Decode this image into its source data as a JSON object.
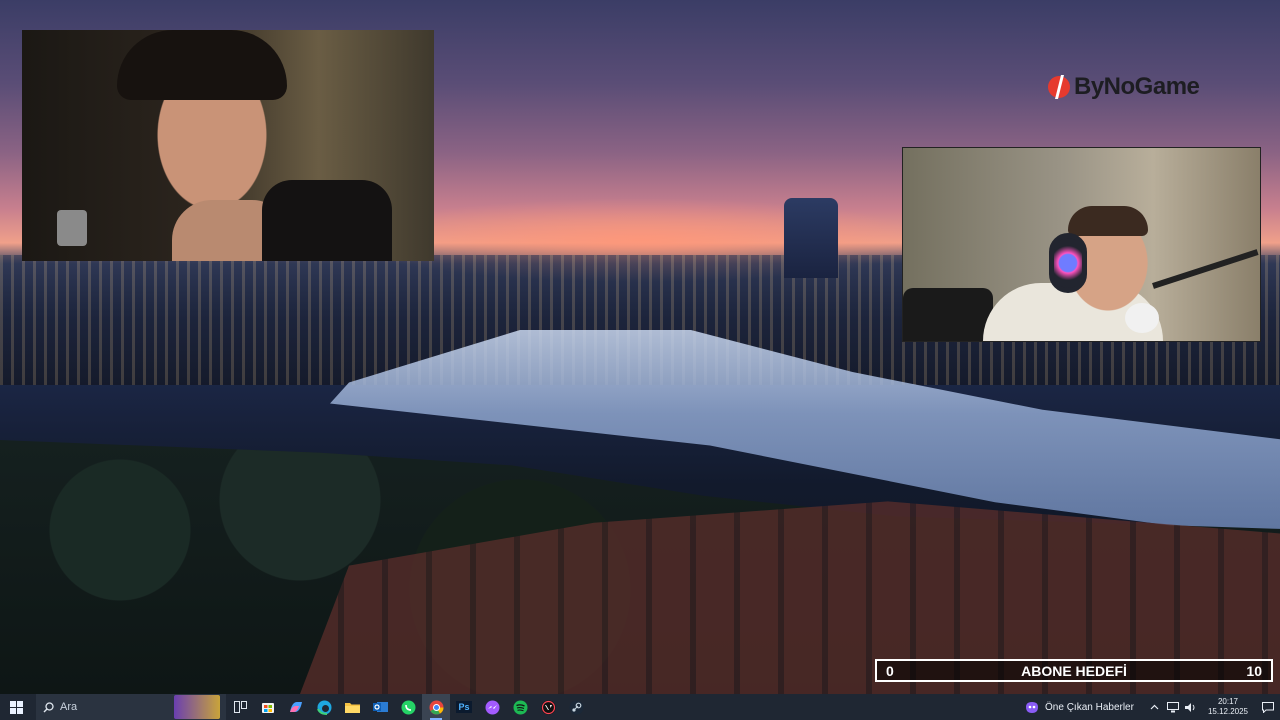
{
  "overlay": {
    "brand_name": "ByNoGame",
    "goal": {
      "current": "0",
      "title": "ABONE HEDEFİ",
      "target": "10",
      "progress": 0
    }
  },
  "taskbar": {
    "search_placeholder": "Ara",
    "apps": [
      "start-icon",
      "task-view-icon",
      "store-icon",
      "copilot-icon",
      "edge-icon",
      "file-explorer-icon",
      "outlook-icon",
      "whatsapp-icon",
      "chrome-icon",
      "photoshop-icon",
      "messenger-icon",
      "spotify-icon",
      "valorant-icon",
      "steam-icon"
    ],
    "photoshop_label": "Ps",
    "news_label": "Öne Çıkan Haberler",
    "clock": {
      "time": "20:17",
      "date": "15.12.2025"
    }
  },
  "colors": {
    "brand_red": "#e63a2e",
    "taskbar_bg": "#1f2733",
    "goal_border": "#ffffff"
  }
}
